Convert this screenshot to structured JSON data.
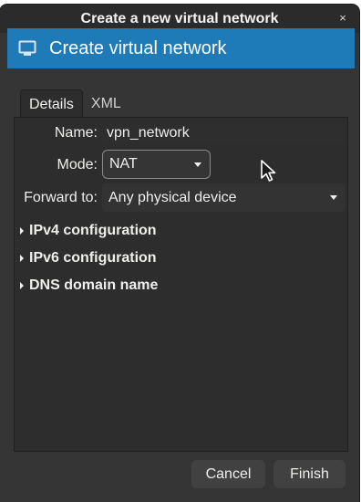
{
  "window": {
    "title": "Create a new virtual network",
    "close_glyph": "×"
  },
  "header": {
    "icon": "network-monitor-icon",
    "text": "Create virtual network",
    "color": "#1f7ab8"
  },
  "tabs": [
    {
      "label": "Details",
      "active": true
    },
    {
      "label": "XML",
      "active": false
    }
  ],
  "form": {
    "name_label": "Name:",
    "name_value": "vpn_network",
    "mode_label": "Mode:",
    "mode_value": "NAT",
    "forward_label": "Forward to:",
    "forward_value": "Any physical device"
  },
  "expanders": [
    {
      "label": "IPv4 configuration"
    },
    {
      "label": "IPv6 configuration"
    },
    {
      "label": "DNS domain name"
    }
  ],
  "buttons": {
    "cancel": "Cancel",
    "finish": "Finish"
  }
}
